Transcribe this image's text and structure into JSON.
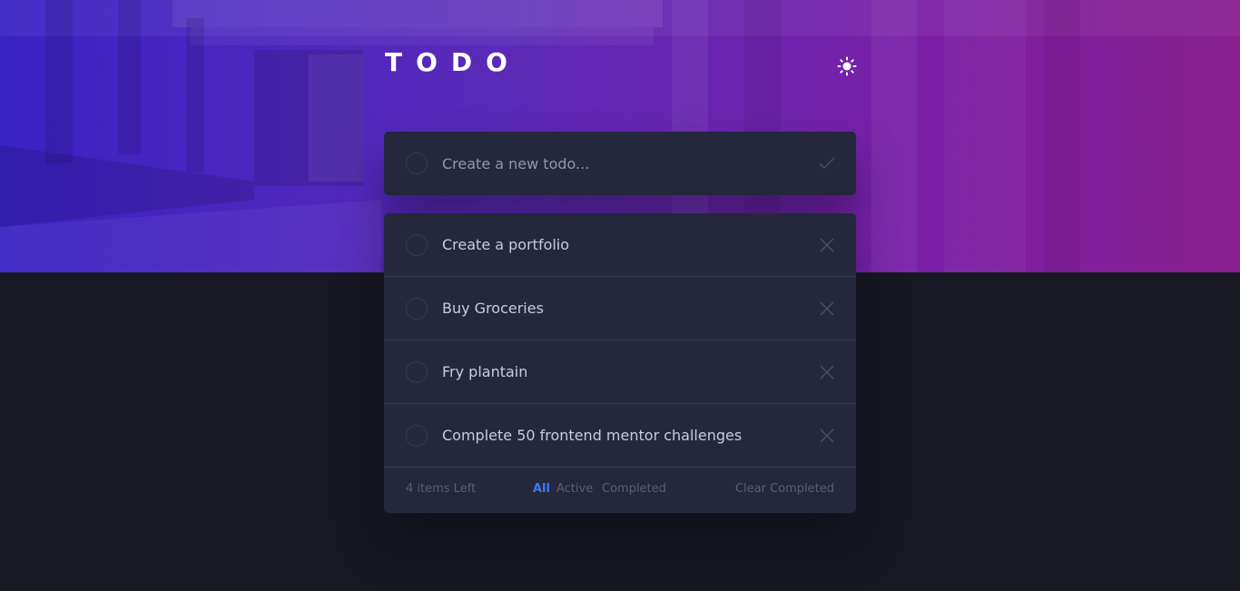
{
  "header": {
    "title": "TODO",
    "theme_toggle_icon": "sun-icon"
  },
  "new_todo": {
    "placeholder": "Create a new todo...",
    "submit_icon": "check-icon"
  },
  "todos": [
    {
      "text": "Create a portfolio",
      "completed": false
    },
    {
      "text": "Buy Groceries",
      "completed": false
    },
    {
      "text": "Fry plantain",
      "completed": false
    },
    {
      "text": "Complete 50 frontend mentor challenges",
      "completed": false
    }
  ],
  "footer": {
    "items_left": "4 items Left",
    "filters": [
      "All",
      "Active",
      "Completed"
    ],
    "active_filter": "All",
    "clear_label": "Clear Completed"
  },
  "colors": {
    "background": "#181824",
    "card": "#25273c",
    "text": "#c8cbe7",
    "muted": "#5b5e7e",
    "accent": "#3a7bfd",
    "hero_gradient_start": "#3a22c4",
    "hero_gradient_end": "#8a1f8f"
  }
}
